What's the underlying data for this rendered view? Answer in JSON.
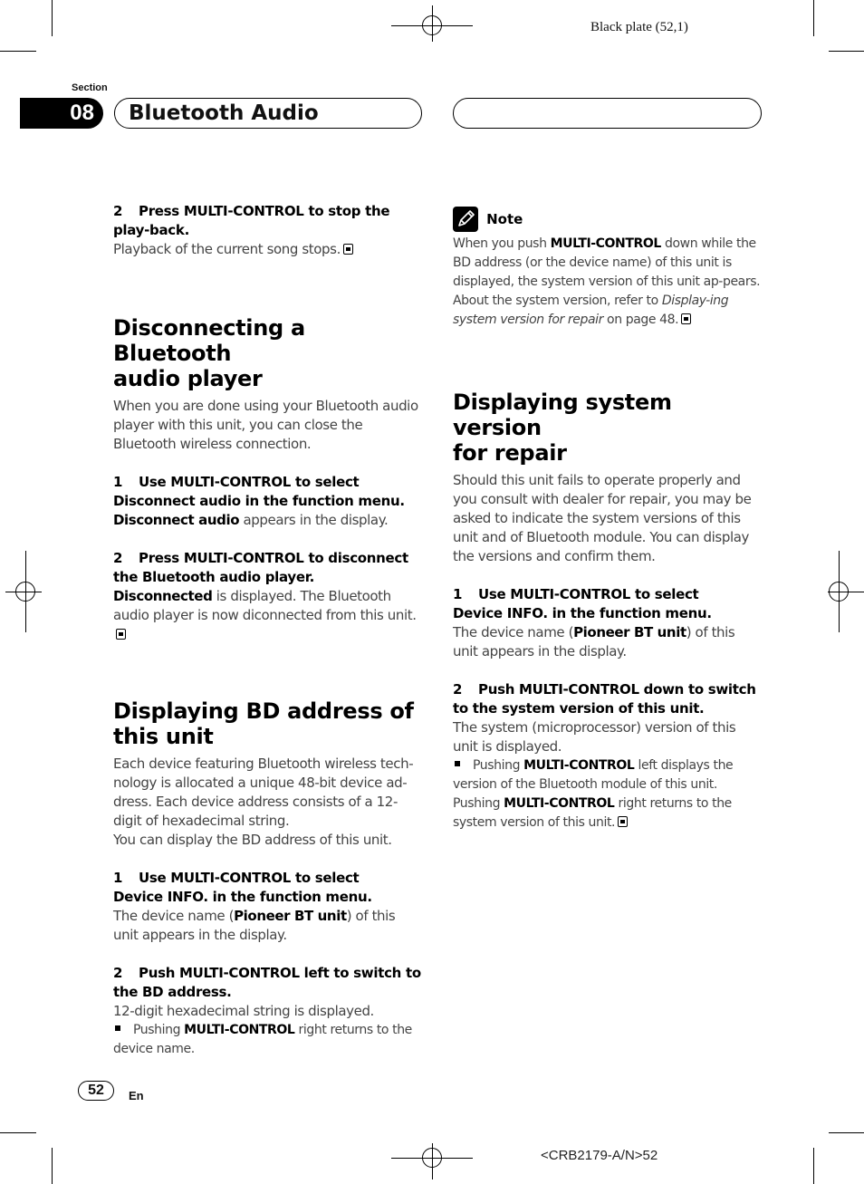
{
  "header": {
    "plate_label": "Black plate (52,1)",
    "section_label": "Section",
    "section_number": "08",
    "section_title": "Bluetooth Audio"
  },
  "left_column": {
    "stop_playback": {
      "step_number": "2",
      "step_text": "Press MULTI-CONTROL to stop the play-back.",
      "body": "Playback of the current song stops."
    },
    "disconnecting": {
      "heading_line1": "Disconnecting a Bluetooth",
      "heading_line2": "audio player",
      "intro": "When you are done using your Bluetooth audio player with this unit, you can close the Bluetooth wireless connection.",
      "step1": {
        "number": "1",
        "line1": "Use MULTI-CONTROL to select",
        "line2": "Disconnect audio in the function menu.",
        "body_bold": "Disconnect audio",
        "body_rest": " appears in the display."
      },
      "step2": {
        "number": "2",
        "line1": "Press MULTI-CONTROL to disconnect",
        "line2": "the Bluetooth audio player.",
        "body_bold": "Disconnected",
        "body_rest": " is displayed. The Bluetooth audio player is now diconnected from this unit."
      }
    },
    "bd_address": {
      "heading_line1": "Displaying BD address of",
      "heading_line2": "this unit",
      "intro1": "Each device featuring Bluetooth wireless tech-nology is allocated a unique 48-bit device ad-dress. Each device address consists of a 12-digit of hexadecimal string.",
      "intro2": "You can display the BD address of this unit.",
      "step1": {
        "number": "1",
        "line1": "Use MULTI-CONTROL to select",
        "line2": "Device INFO. in the function menu.",
        "body_pre": "The device name (",
        "body_bold": "Pioneer BT unit",
        "body_post": ") of this unit appears in the display."
      },
      "step2": {
        "number": "2",
        "line1": "Push MULTI-CONTROL left to switch to",
        "line2": "the BD address.",
        "body": "12-digit hexadecimal string is displayed.",
        "bullet_pre": "Pushing ",
        "bullet_bold": "MULTI-CONTROL",
        "bullet_post": " right returns to the device name."
      }
    }
  },
  "right_column": {
    "note": {
      "title": "Note",
      "text_pre": "When you push ",
      "text_bold": "MULTI-CONTROL",
      "text_mid": " down while the BD address (or the device name) of this unit is displayed, the system version of this unit ap-pears. About the system version, refer to ",
      "text_italic": "Display-ing system version for repair",
      "text_post": " on page 48."
    },
    "system_version": {
      "heading_line1": "Displaying system version",
      "heading_line2": "for repair",
      "intro": "Should this unit fails to operate properly and you consult with dealer for repair, you may be asked to indicate the system versions of this unit and of Bluetooth module. You can display the versions and confirm them.",
      "step1": {
        "number": "1",
        "line1": "Use MULTI-CONTROL to select",
        "line2": "Device INFO. in the function menu.",
        "body_pre": "The device name (",
        "body_bold": "Pioneer BT unit",
        "body_post": ") of this unit appears in the display."
      },
      "step2": {
        "number": "2",
        "line1": "Push MULTI-CONTROL down to switch",
        "line2": "to the system version of this unit.",
        "body": "The system (microprocessor) version of this unit is displayed.",
        "bullet_pre": "Pushing ",
        "bullet_bold": "MULTI-CONTROL",
        "bullet_mid": " left displays the version of the Bluetooth module of this unit. Pushing ",
        "bullet_bold2": "MULTI-CONTROL",
        "bullet_post": " right returns to the system version of this unit."
      }
    }
  },
  "footer": {
    "page_number": "52",
    "language": "En",
    "doc_code": "<CRB2179-A/N>52"
  }
}
